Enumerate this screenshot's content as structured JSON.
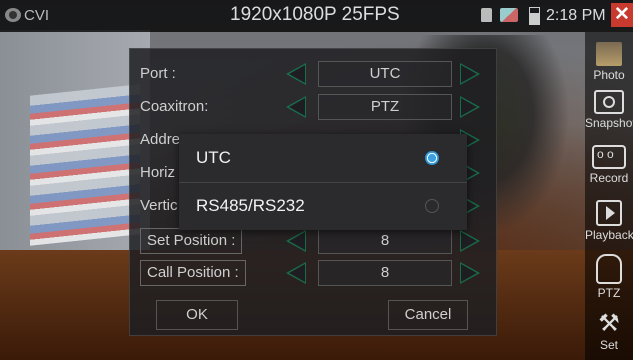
{
  "status_bar": {
    "mode": "CVI",
    "resolution": "1920x1080P 25FPS",
    "time": "2:18 PM",
    "close_label": "✕"
  },
  "sidebar": {
    "items": [
      {
        "label": "Photo",
        "icon": "photo-icon"
      },
      {
        "label": "Snapshot",
        "icon": "camera-icon"
      },
      {
        "label": "Record",
        "icon": "video-camera-icon"
      },
      {
        "label": "Playback",
        "icon": "play-icon"
      },
      {
        "label": "PTZ",
        "icon": "ptz-camera-icon"
      },
      {
        "label": "Set",
        "icon": "tools-icon"
      }
    ]
  },
  "panel": {
    "rows": [
      {
        "label": "Port :",
        "value": "UTC"
      },
      {
        "label": "Coaxitron:",
        "value": "PTZ"
      },
      {
        "label": "Addre",
        "value": ""
      },
      {
        "label": "Horiz",
        "value": ""
      },
      {
        "label": "Vertic",
        "value": ""
      },
      {
        "label": "Set Position :",
        "value": "8"
      },
      {
        "label": "Call Position :",
        "value": "8"
      }
    ],
    "ok_label": "OK",
    "cancel_label": "Cancel"
  },
  "popup": {
    "options": [
      {
        "label": "UTC",
        "selected": true
      },
      {
        "label": "RS485/RS232",
        "selected": false
      }
    ]
  },
  "colors": {
    "accent": "#3aa0e0",
    "arrow": "#148c5a",
    "close": "#c93a2e"
  }
}
